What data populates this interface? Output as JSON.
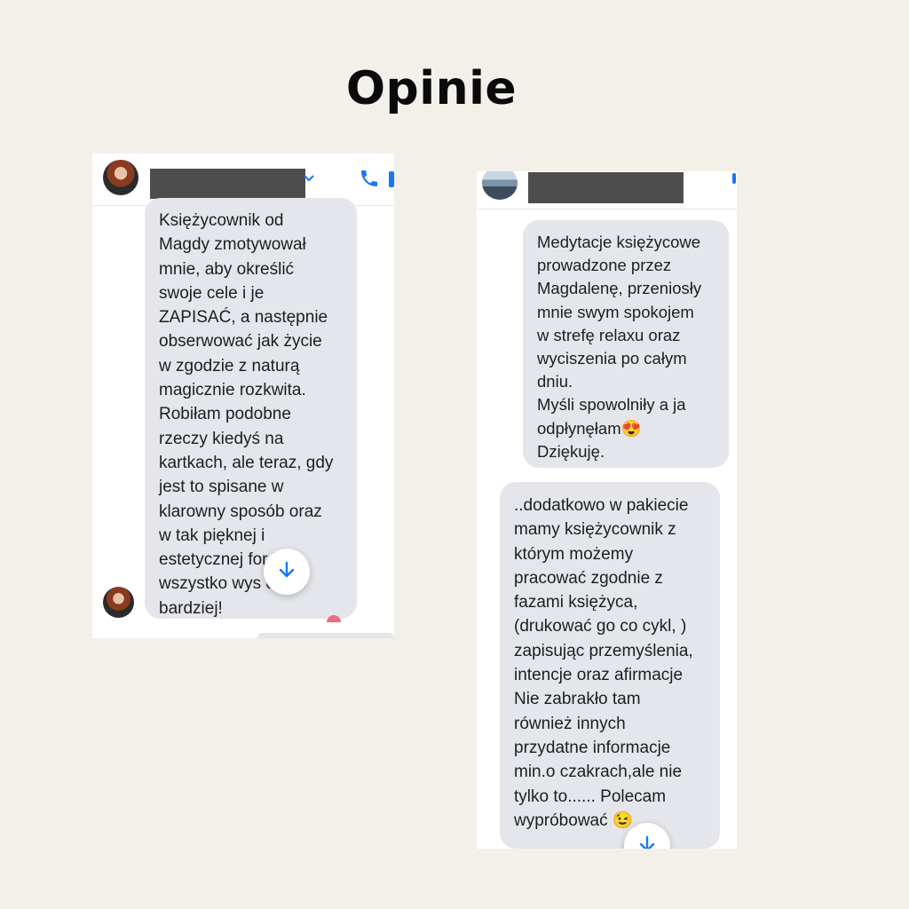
{
  "title": "Opinie",
  "left_chat": {
    "message_lines": [
      "Księżycownik od",
      "Magdy zmotywował",
      "mnie, aby określić",
      "swoje cele i je",
      "ZAPISAĆ, a następnie",
      "obserwować jak życie",
      "w zgodzie z naturą",
      "magicznie rozkwita.",
      "Robiłam podobne",
      "rzeczy kiedyś na",
      "kartkach, ale teraz, gdy",
      "jest to spisane w",
      "klarowny sposób oraz",
      "w tak pięknej i",
      "estetycznej for     ie -",
      "wszystko wys     o",
      "bardziej!"
    ],
    "icons": {
      "call": "phone-icon",
      "dropdown": "chevron-down-icon",
      "scroll": "arrow-down-icon"
    }
  },
  "right_chat": {
    "message1_lines": [
      "Medytacje księżycowe",
      "prowadzone  przez",
      "Magdalenę, przeniosły",
      "mnie swym spokojem",
      "w strefę relaxu oraz",
      "wyciszenia po całym",
      "dniu.",
      "Myśli spowolniły a ja",
      "odpłynęłam😍",
      "Dziękuję."
    ],
    "message2_lines": [
      "..dodatkowo w pakiecie",
      "mamy księżycownik z",
      "którym możemy",
      "pracować zgodnie z",
      "fazami księżyca,",
      "(drukować go co cykl, )",
      "zapisując przemyślenia,",
      "intencje oraz afirmacje",
      "Nie zabrakło tam",
      "również innych",
      "przydatne informacje",
      "min.o  czakrach,ale nie",
      "tylko to...... Polecam",
      "wypróbować 😉"
    ],
    "icons": {
      "scroll": "arrow-down-icon"
    }
  },
  "colors": {
    "background": "#f3f0ea",
    "bubble": "#e4e6eb",
    "accent": "#1877f2",
    "redaction": "#4d4d4d"
  }
}
